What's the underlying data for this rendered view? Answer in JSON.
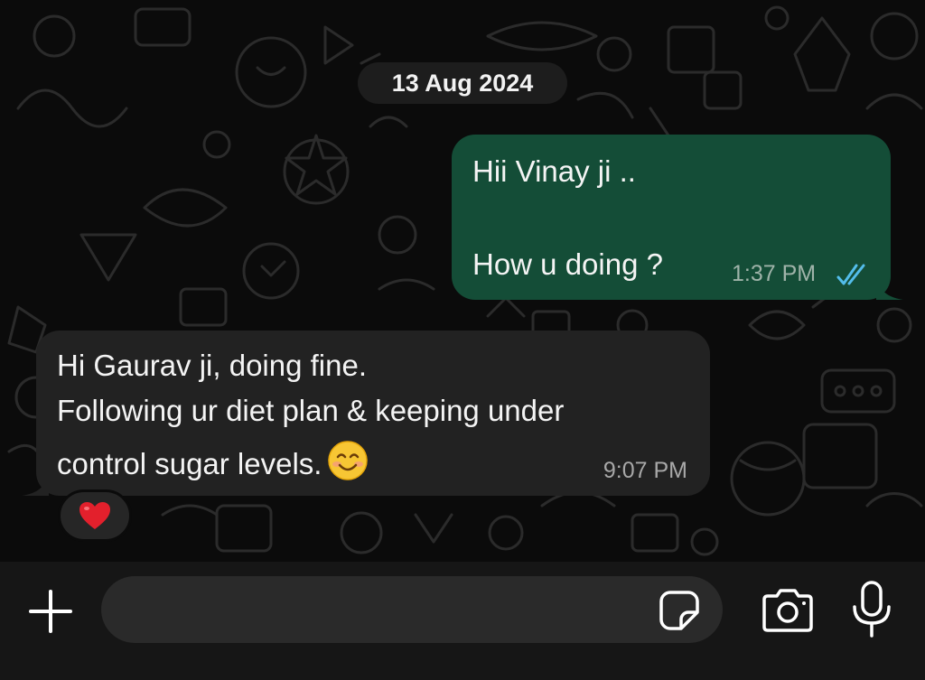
{
  "chat": {
    "date_chip": "13 Aug 2024",
    "messages": [
      {
        "direction": "outgoing",
        "lines": [
          "Hii Vinay ji ..",
          "How u doing ?"
        ],
        "time": "1:37 PM",
        "status": "read",
        "status_icon": "double-check-icon",
        "bubble_color": "#144d37"
      },
      {
        "direction": "incoming",
        "lines": [
          "Hi Gaurav ji, doing fine.",
          "Following ur diet plan & keeping under",
          "control sugar levels."
        ],
        "emoji": "smiling-face-icon",
        "time": "9:07 PM",
        "bubble_color": "#222222",
        "reaction": "red-heart-icon"
      }
    ]
  },
  "composer": {
    "placeholder": "",
    "value": "",
    "icons": [
      "plus-icon",
      "sticker-icon",
      "camera-icon",
      "microphone-icon"
    ]
  },
  "colors": {
    "background": "#0b0b0b",
    "outgoing_bubble": "#144d37",
    "incoming_bubble": "#222222",
    "read_ticks": "#53bdeb",
    "bottom_bar": "#161616"
  }
}
